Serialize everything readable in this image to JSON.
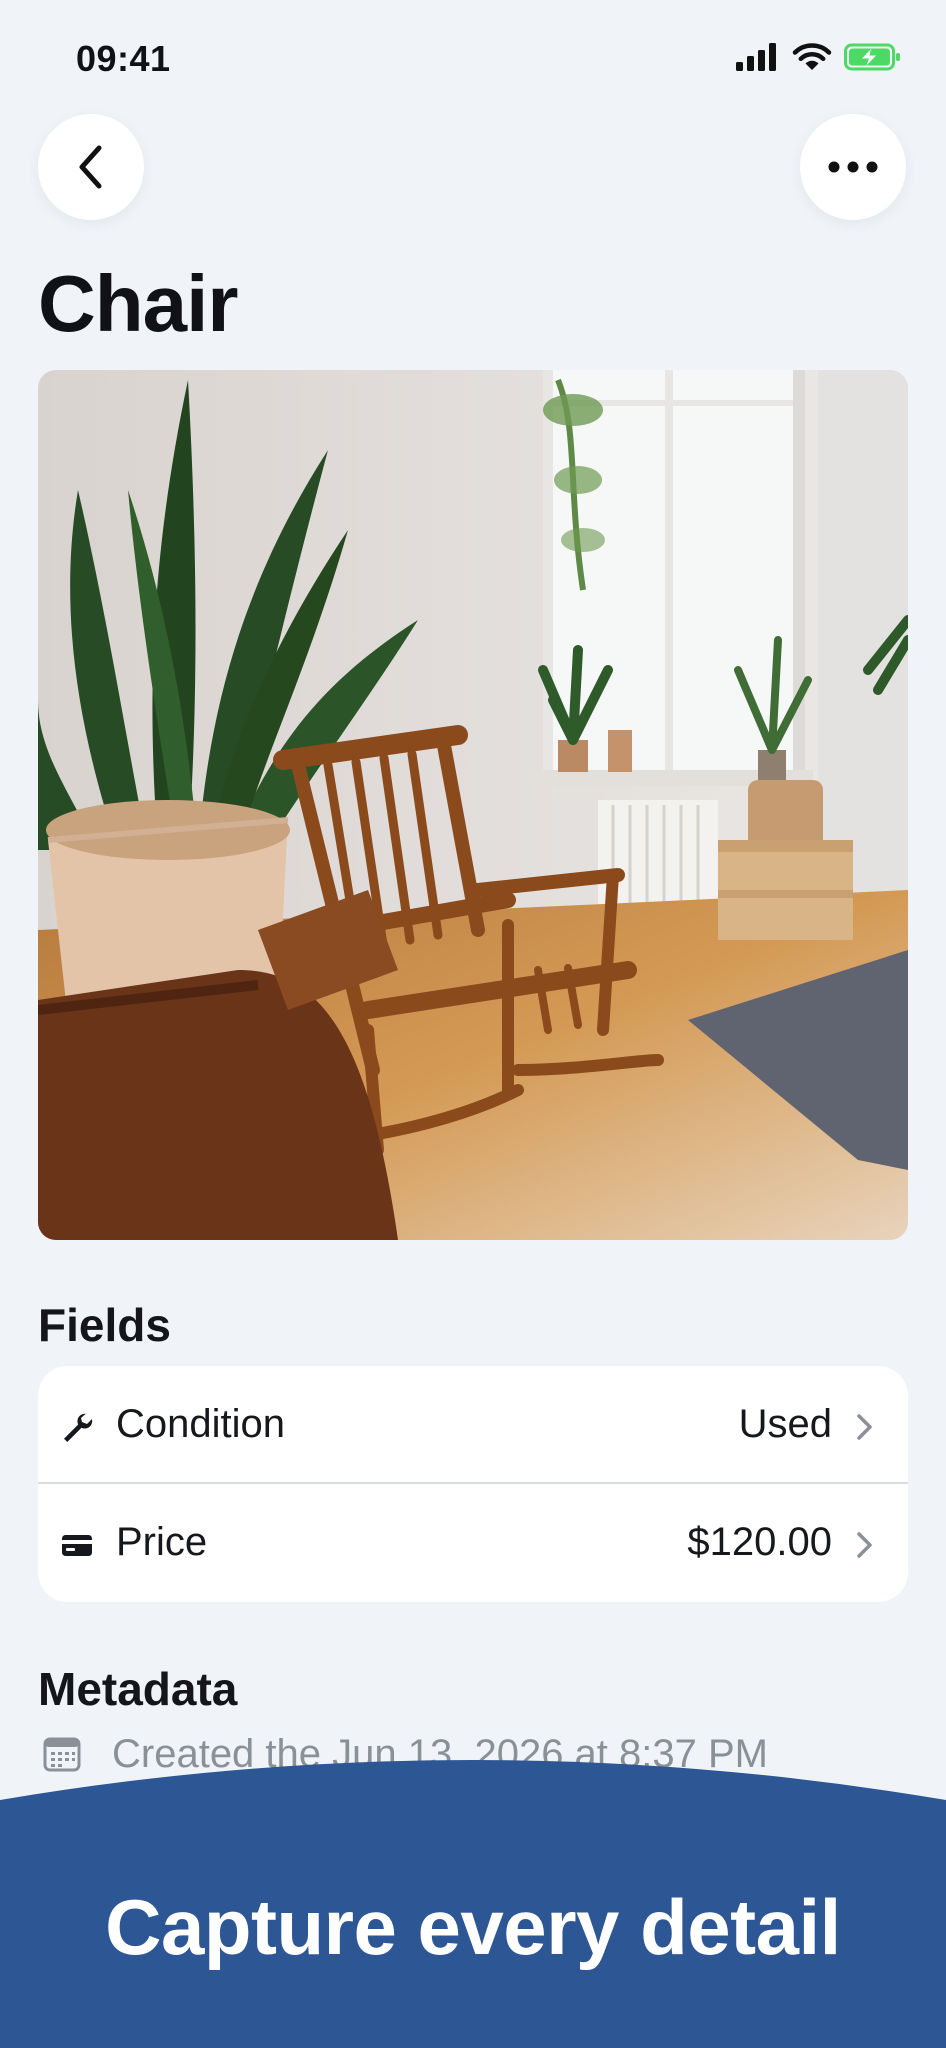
{
  "status_bar": {
    "time": "09:41"
  },
  "header": {
    "back_icon": "chevron-left-icon",
    "more_icon": "ellipsis-icon",
    "title": "Chair"
  },
  "photo": {
    "subject": "wooden-rocking-chair-photo"
  },
  "fields": {
    "section_title": "Fields",
    "rows": [
      {
        "icon": "wrench-icon",
        "label": "Condition",
        "value": "Used"
      },
      {
        "icon": "credit-card-icon",
        "label": "Price",
        "value": "$120.00"
      }
    ]
  },
  "metadata": {
    "section_title": "Metadata",
    "created": "Created the Jun 13, 2026 at 8:37 PM"
  },
  "banner": {
    "text": "Capture every detail",
    "color": "#2d5694"
  },
  "colors": {
    "background": "#f0f4f8",
    "card": "#ffffff",
    "battery": "#4cd964"
  }
}
